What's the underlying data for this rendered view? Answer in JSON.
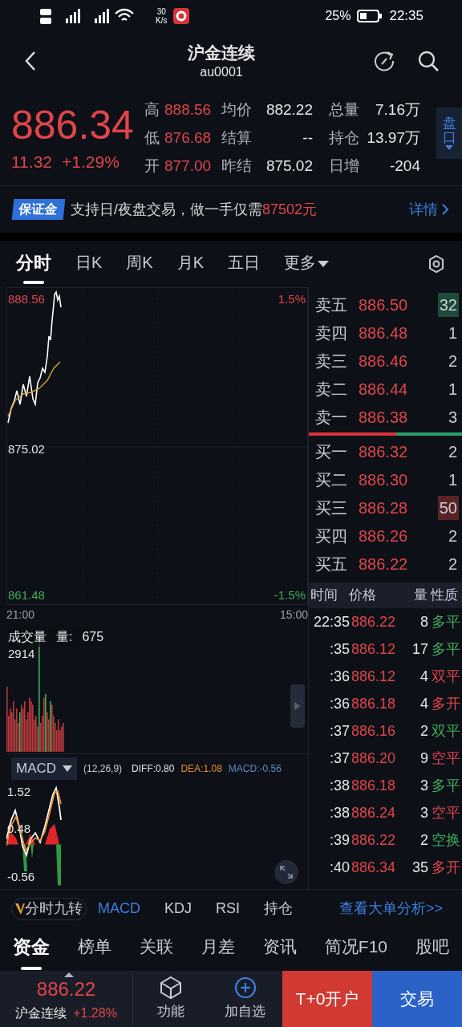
{
  "status_bar": {
    "speed": "30",
    "speed_unit": "K/s",
    "battery": "25%",
    "time": "22:35"
  },
  "header": {
    "title": "沪金连续",
    "code": "au0001"
  },
  "quote": {
    "price": "886.34",
    "change": "11.32",
    "change_pct": "+1.29%",
    "stats": [
      {
        "label": "高",
        "value": "888.56",
        "color": "#e0454a"
      },
      {
        "label": "均价",
        "value": "882.22",
        "color": "#e6e6e6"
      },
      {
        "label": "总量",
        "value": "7.16万",
        "color": "#e6e6e6"
      },
      {
        "label": "低",
        "value": "876.68",
        "color": "#e0454a"
      },
      {
        "label": "结算",
        "value": "--",
        "color": "#e6e6e6"
      },
      {
        "label": "持仓",
        "value": "13.97万",
        "color": "#e6e6e6"
      },
      {
        "label": "开",
        "value": "877.00",
        "color": "#e0454a"
      },
      {
        "label": "昨结",
        "value": "875.02",
        "color": "#e6e6e6"
      },
      {
        "label": "日增",
        "value": "-204",
        "color": "#e6e6e6"
      }
    ],
    "side_tab": "盘口"
  },
  "banner": {
    "badge": "保证金",
    "text": "支持日/夜盘交易，做一手仅需",
    "amount": "87502元",
    "link": "详情"
  },
  "chart_tabs": [
    {
      "label": "分时",
      "selected": true
    },
    {
      "label": "日K",
      "selected": false
    },
    {
      "label": "周K",
      "selected": false
    },
    {
      "label": "月K",
      "selected": false
    },
    {
      "label": "五日",
      "selected": false
    },
    {
      "label": "更多",
      "selected": false
    }
  ],
  "price_chart": {
    "high": "888.56",
    "high_pct": "1.5%",
    "base": "875.02",
    "low": "861.48",
    "low_pct": "-1.5%",
    "start": "21:00",
    "end": "15:00"
  },
  "volume": {
    "title": "成交量",
    "label": "量:",
    "value": "675",
    "max": "2914"
  },
  "macd": {
    "name": "MACD",
    "params": "(12,26,9)",
    "diff": "DIFF:0.80",
    "dea": "DEA:1.08",
    "macd": "MACD:-0.56",
    "ticks": [
      "1.52",
      "0.48",
      "-0.56"
    ]
  },
  "order_book": {
    "asks": [
      {
        "label": "卖五",
        "price": "886.50",
        "volume": "32",
        "highlighted": true
      },
      {
        "label": "卖四",
        "price": "886.48",
        "volume": "1",
        "highlighted": false
      },
      {
        "label": "卖三",
        "price": "886.46",
        "volume": "2",
        "highlighted": false
      },
      {
        "label": "卖二",
        "price": "886.44",
        "volume": "1",
        "highlighted": false
      },
      {
        "label": "卖一",
        "price": "886.38",
        "volume": "3",
        "highlighted": false
      }
    ],
    "balance": {
      "level": 0.57
    },
    "bids": [
      {
        "label": "买一",
        "price": "886.32",
        "volume": "2",
        "highlighted": false
      },
      {
        "label": "买二",
        "price": "886.30",
        "volume": "1",
        "highlighted": false
      },
      {
        "label": "买三",
        "price": "886.28",
        "volume": "50",
        "highlighted": true
      },
      {
        "label": "买四",
        "price": "886.26",
        "volume": "2",
        "highlighted": false
      },
      {
        "label": "买五",
        "price": "886.22",
        "volume": "2",
        "highlighted": false
      }
    ]
  },
  "trades": {
    "columns": [
      "时间",
      "价格",
      "量",
      "性质"
    ],
    "rows": [
      {
        "time": "22:35",
        "price": "886.22",
        "volume": "8",
        "nature": "多平",
        "color": "#3fae5a"
      },
      {
        "time": ":35",
        "price": "886.12",
        "volume": "17",
        "nature": "多平",
        "color": "#3fae5a"
      },
      {
        "time": ":36",
        "price": "886.12",
        "volume": "4",
        "nature": "双平",
        "color": "#e0454a"
      },
      {
        "time": ":36",
        "price": "886.18",
        "volume": "4",
        "nature": "多开",
        "color": "#e0454a"
      },
      {
        "time": ":37",
        "price": "886.16",
        "volume": "2",
        "nature": "双平",
        "color": "#3fae5a"
      },
      {
        "time": ":37",
        "price": "886.20",
        "volume": "9",
        "nature": "空平",
        "color": "#e0454a"
      },
      {
        "time": ":38",
        "price": "886.18",
        "volume": "3",
        "nature": "多平",
        "color": "#3fae5a"
      },
      {
        "time": ":38",
        "price": "886.24",
        "volume": "3",
        "nature": "空平",
        "color": "#e0454a"
      },
      {
        "time": ":39",
        "price": "886.22",
        "volume": "2",
        "nature": "空换",
        "color": "#3fae5a"
      },
      {
        "time": ":40",
        "price": "886.34",
        "volume": "35",
        "nature": "多开",
        "color": "#e0454a"
      }
    ]
  },
  "indicators": [
    {
      "label": "分时九转",
      "kind": "badge",
      "selected": false
    },
    {
      "label": "MACD",
      "kind": "plain",
      "selected": true
    },
    {
      "label": "KDJ",
      "kind": "plain",
      "selected": false
    },
    {
      "label": "RSI",
      "kind": "plain",
      "selected": false
    },
    {
      "label": "持仓",
      "kind": "plain",
      "selected": false
    }
  ],
  "indicator_link": "查看大单分析>>",
  "bottom_tabs": [
    {
      "label": "资金",
      "selected": true
    },
    {
      "label": "榜单",
      "selected": false
    },
    {
      "label": "关联",
      "selected": false
    },
    {
      "label": "月差",
      "selected": false
    },
    {
      "label": "资讯",
      "selected": false
    },
    {
      "label": "简况F10",
      "selected": false
    },
    {
      "label": "股吧",
      "selected": false
    }
  ],
  "bottom_bar": {
    "price": "886.22",
    "name": "沪金连续",
    "change_pct": "+1.28%",
    "actions": [
      {
        "label": "功能",
        "kind": "cube"
      },
      {
        "label": "加自选",
        "kind": "add"
      }
    ],
    "buttons": [
      {
        "label": "T+0开户",
        "kind": "open"
      },
      {
        "label": "交易",
        "kind": "trade"
      }
    ]
  }
}
